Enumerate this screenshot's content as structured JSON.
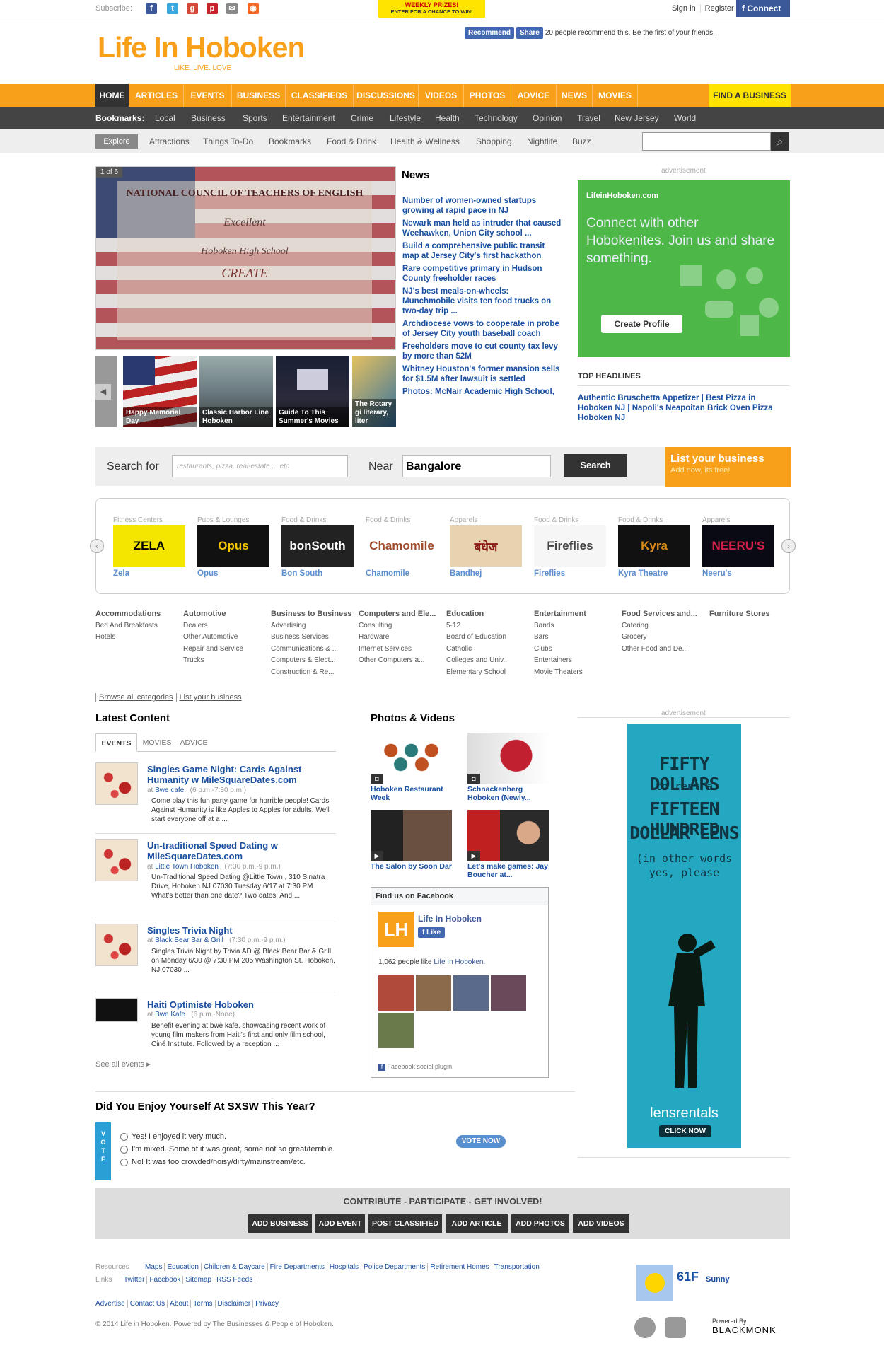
{
  "topbar": {
    "subscribe_label": "Subscribe:",
    "social_icons": [
      "facebook-icon",
      "twitter-icon",
      "google-plus-icon",
      "pinterest-icon",
      "email-icon",
      "rss-icon"
    ],
    "prize_title": "WEEKLY PRIZES!",
    "prize_sub": "ENTER FOR A CHANCE TO WIN!",
    "signin": "Sign in",
    "register": "Register",
    "connect": "Connect"
  },
  "header": {
    "logo": "Life In Hoboken",
    "tagline": "LIKE. LIVE. LOVE",
    "recommend_btn": "Recommend",
    "share_btn": "Share",
    "recommend_text": "20 people recommend this. Be the first of your friends."
  },
  "nav": {
    "items": [
      "HOME",
      "ARTICLES",
      "EVENTS",
      "BUSINESS",
      "CLASSIFIEDS",
      "DISCUSSIONS",
      "VIDEOS",
      "PHOTOS",
      "ADVICE",
      "NEWS",
      "MOVIES"
    ],
    "find_business": "FIND A BUSINESS"
  },
  "bookmarks": {
    "label": "Bookmarks:",
    "items": [
      "Local",
      "Business",
      "Sports",
      "Entertainment",
      "Crime",
      "Lifestyle",
      "Health",
      "Technology",
      "Opinion",
      "Travel",
      "New Jersey",
      "World"
    ]
  },
  "explore": {
    "button": "Explore",
    "items": [
      "Attractions",
      "Things To-Do",
      "Bookmarks",
      "Food & Drink",
      "Health & Wellness",
      "Shopping",
      "Nightlife",
      "Buzz"
    ]
  },
  "slider": {
    "counter": "1 of 6",
    "cert_org": "NATIONAL COUNCIL OF TEACHERS OF ENGLISH",
    "cert_award": "Excellent",
    "cert_school": "Hoboken High School",
    "cert_pub": "CREATE",
    "thumbs": [
      "Happy Memorial Day",
      "Classic Harbor Line Hoboken",
      "Guide To This Summer's Movies",
      "The Rotary gi literary, liter"
    ]
  },
  "news": {
    "heading": "News",
    "items": [
      "Number of women-owned startups growing at rapid pace in NJ",
      "Newark man held as intruder that caused Weehawken, Union City school ...",
      "Build a comprehensive public transit map at Jersey City's first hackathon",
      "Rare competitive primary in Hudson County freeholder races",
      "NJ's best meals-on-wheels: Munchmobile visits ten food trucks on two-day trip ...",
      "Archdiocese vows to cooperate in probe of Jersey City youth baseball coach",
      "Freeholders move to cut county tax levy by more than $2M",
      "Whitney Houston's former mansion sells for $1.5M after lawsuit is settled",
      "Photos: McNair Academic High School,"
    ]
  },
  "right_ad": {
    "label": "advertisement",
    "site": "LifeinHoboken.com",
    "message": "Connect with other Hobokenites. Join us and share something.",
    "button": "Create Profile"
  },
  "top_headlines": {
    "heading": "TOP HEADLINES",
    "text": "Authentic Bruschetta Appetizer | Best Pizza in Hoboken NJ | Napoli's Neapoitan Brick Oven Pizza Hoboken NJ"
  },
  "search": {
    "for_label": "Search for",
    "for_placeholder": "restaurants, pizza, real-estate ... etc",
    "near_label": "Near",
    "near_value": "Bangalore",
    "button": "Search",
    "list_title": "List your business",
    "list_sub": "Add now, its free!"
  },
  "businesses": [
    {
      "cat": "Fitness Centers",
      "name": "Zela",
      "logo": "ZELA",
      "bg": "#f5e600",
      "fg": "#000"
    },
    {
      "cat": "Pubs & Lounges",
      "name": "Opus",
      "logo": "Opus",
      "bg": "#111",
      "fg": "#f5c400"
    },
    {
      "cat": "Food & Drinks",
      "name": "Bon South",
      "logo": "bonSouth",
      "bg": "#222",
      "fg": "#fff"
    },
    {
      "cat": "Food & Drinks",
      "name": "Chamomile",
      "logo": "Chamomile",
      "bg": "#fff",
      "fg": "#a04a2a"
    },
    {
      "cat": "Apparels",
      "name": "Bandhej",
      "logo": "बंधेज",
      "bg": "#e8d3b0",
      "fg": "#8a1a14"
    },
    {
      "cat": "Food & Drinks",
      "name": "Fireflies",
      "logo": "Fireflies",
      "bg": "#f6f6f6",
      "fg": "#444"
    },
    {
      "cat": "Food & Drinks",
      "name": "Kyra Theatre",
      "logo": "Kyra",
      "bg": "#111",
      "fg": "#d98a1a"
    },
    {
      "cat": "Apparels",
      "name": "Neeru's",
      "logo": "NEERU'S",
      "bg": "#0a0a14",
      "fg": "#d0204a"
    }
  ],
  "categories": [
    {
      "h": "Accommodations",
      "items": [
        "Bed And Breakfasts",
        "Hotels"
      ]
    },
    {
      "h": "Automotive",
      "items": [
        "Dealers",
        "Other Automotive",
        "Repair and Service",
        "Trucks"
      ]
    },
    {
      "h": "Business to Business",
      "items": [
        "Advertising",
        "Business Services",
        "Communications & ...",
        "Computers & Elect...",
        "Construction & Re..."
      ]
    },
    {
      "h": "Computers and Ele...",
      "items": [
        "Consulting",
        "Hardware",
        "Internet Services",
        "Other Computers a..."
      ]
    },
    {
      "h": "Education",
      "items": [
        "5-12",
        "Board of Education",
        "Catholic",
        "Colleges and Univ...",
        "Elementary School"
      ]
    },
    {
      "h": "Entertainment",
      "items": [
        "Bands",
        "Bars",
        "Clubs",
        "Entertainers",
        "Movie Theaters"
      ]
    },
    {
      "h": "Food Services and...",
      "items": [
        "Catering",
        "Grocery",
        "Other Food and De..."
      ]
    },
    {
      "h": "Furniture Stores",
      "items": []
    }
  ],
  "browse": {
    "all": "Browse all categories",
    "list": "List your business"
  },
  "latest": {
    "heading": "Latest Content",
    "tabs": [
      "EVENTS",
      "MOVIES",
      "ADVICE"
    ],
    "events": [
      {
        "title": "Singles Game Night: Cards Against Humanity w MileSquareDates.com",
        "at": "at",
        "venue": "Bwe cafe",
        "time": "(6 p.m.-7:30 p.m.)",
        "desc": "Come play this fun party game for horrible people! Cards Against Humanity is like Apples to Apples for adults. We'll start everyone off at a ..."
      },
      {
        "title": "Un-traditional Speed Dating w MileSquareDates.com",
        "at": "at",
        "venue": "Little Town Hoboken",
        "time": "(7:30 p.m.-9 p.m.)",
        "desc": "Un-Traditional Speed Dating @Little Town , 310 Sinatra Drive, Hoboken NJ 07030 Tuesday 6/17 at 7:30 PM What's better than one date?  Two dates! And ..."
      },
      {
        "title": "Singles Trivia Night",
        "at": "at",
        "venue": "Black Bear Bar & Grill",
        "time": "(7:30 p.m.-9 p.m.)",
        "desc": "Singles Trivia Night by Trivia AD @ Black Bear Bar & Grill on Monday 6/30 @ 7:30 PM                          205 Washington St. Hoboken, NJ 07030 ..."
      },
      {
        "title": "Haiti Optimiste Hoboken",
        "at": "at",
        "venue": "Bwe Kafe",
        "time": "(6 p.m.-None)",
        "desc": "Benefit evening at bwè kafe, showcasing recent work of young film makers from Haiti's first and only film school, Ciné Institute. Followed by a reception ..."
      }
    ],
    "see_all": "See all events"
  },
  "photos": {
    "heading": "Photos & Videos",
    "items": [
      "Hoboken Restaurant Week",
      "Schnackenberg Hoboken (Newly...",
      "The Salon by Soon Dar",
      "Let's make games: Jay Boucher at..."
    ]
  },
  "facebook": {
    "heading": "Find us on Facebook",
    "page": "Life In Hoboken",
    "like": "Like",
    "count_pre": "1,062 people like",
    "count_link": "Life In Hoboken.",
    "plugin": "Facebook social plugin"
  },
  "lens_ad": {
    "label": "advertisement",
    "l1": "FIFTY DOLLARS",
    "l2": "to rent a",
    "l3": "FIFTEEN HUNDRED",
    "l4": "DOLLAR LENS",
    "l5": "(in other words",
    "l6": "yes, please",
    "brand": "lensrentals",
    "cta": "CLICK NOW"
  },
  "poll": {
    "question": "Did You Enjoy Yourself At SXSW This Year?",
    "vote_label": "VOTE",
    "options": [
      "Yes! I enjoyed it very much.",
      "I'm mixed. Some of it was great, some not so great/terrible.",
      "No! It was too crowded/noisy/dirty/mainstream/etc."
    ],
    "button": "VOTE NOW"
  },
  "contribute": {
    "heading": "CONTRIBUTE - PARTICIPATE - GET INVOLVED!",
    "buttons": [
      "ADD BUSINESS",
      "ADD EVENT",
      "POST CLASSIFIED",
      "ADD ARTICLE",
      "ADD PHOTOS",
      "ADD VIDEOS"
    ]
  },
  "footer": {
    "resources_label": "Resources",
    "resources": [
      "Maps",
      "Education",
      "Children & Daycare",
      "Fire Departments",
      "Hospitals",
      "Police Departments",
      "Retirement Homes",
      "Transportation"
    ],
    "links_label": "Links",
    "links": [
      "Twitter",
      "Facebook",
      "Sitemap",
      "RSS Feeds"
    ],
    "bottom_links": [
      "Advertise",
      "Contact Us",
      "About",
      "Terms",
      "Disclaimer",
      "Privacy"
    ],
    "copyright": "© 2014 Life in Hoboken. Powered by The Businesses & People of Hoboken.",
    "weather_temp": "61F",
    "weather_cond": "Sunny",
    "powered_label": "Powered By",
    "powered_brand": "BLACKMONK"
  }
}
